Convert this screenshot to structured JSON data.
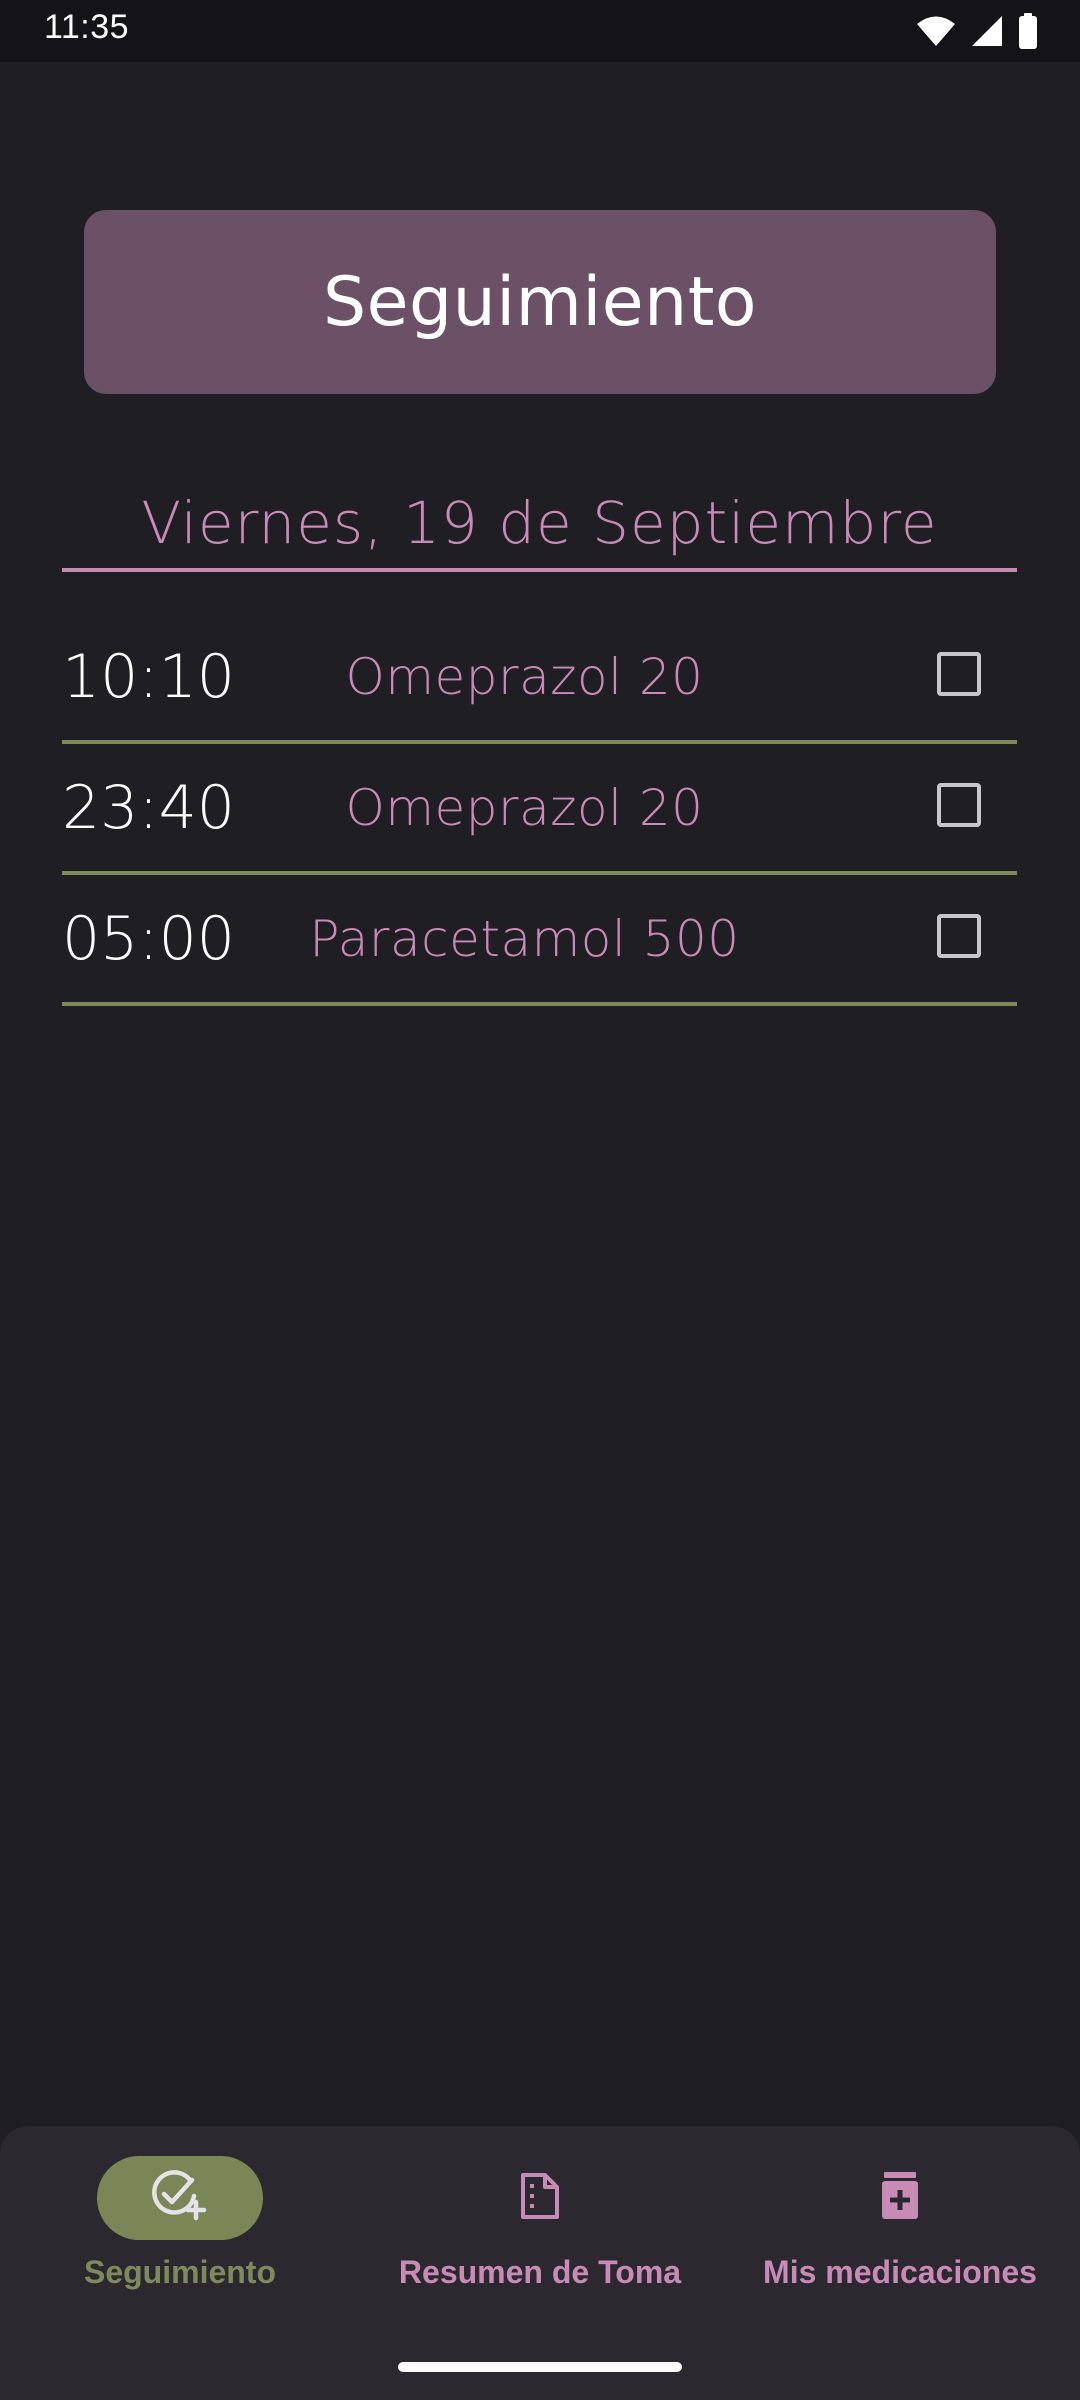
{
  "status_bar": {
    "time": "11:35",
    "icons": [
      "wifi-icon",
      "signal-icon",
      "battery-icon"
    ]
  },
  "header": {
    "title": "Seguimiento"
  },
  "date": "Viernes, 19 de Septiembre",
  "medications": [
    {
      "time": "10:10",
      "name": "Omeprazol 20",
      "checked": false
    },
    {
      "time": "23:40",
      "name": "Omeprazol 20",
      "checked": false
    },
    {
      "time": "05:00",
      "name": "Paracetamol 500",
      "checked": false
    }
  ],
  "bottom_nav": {
    "items": [
      {
        "label": "Seguimiento",
        "icon": "check-circle-add-icon",
        "active": true
      },
      {
        "label": "Resumen de Toma",
        "icon": "document-icon",
        "active": false
      },
      {
        "label": "Mis medicaciones",
        "icon": "medicine-bottle-icon",
        "active": false
      }
    ]
  },
  "colors": {
    "background": "#1f1e23",
    "header_card": "#6b5066",
    "accent_pink": "#c88bb6",
    "accent_green": "#7a8656",
    "nav_background": "#2b2830"
  }
}
